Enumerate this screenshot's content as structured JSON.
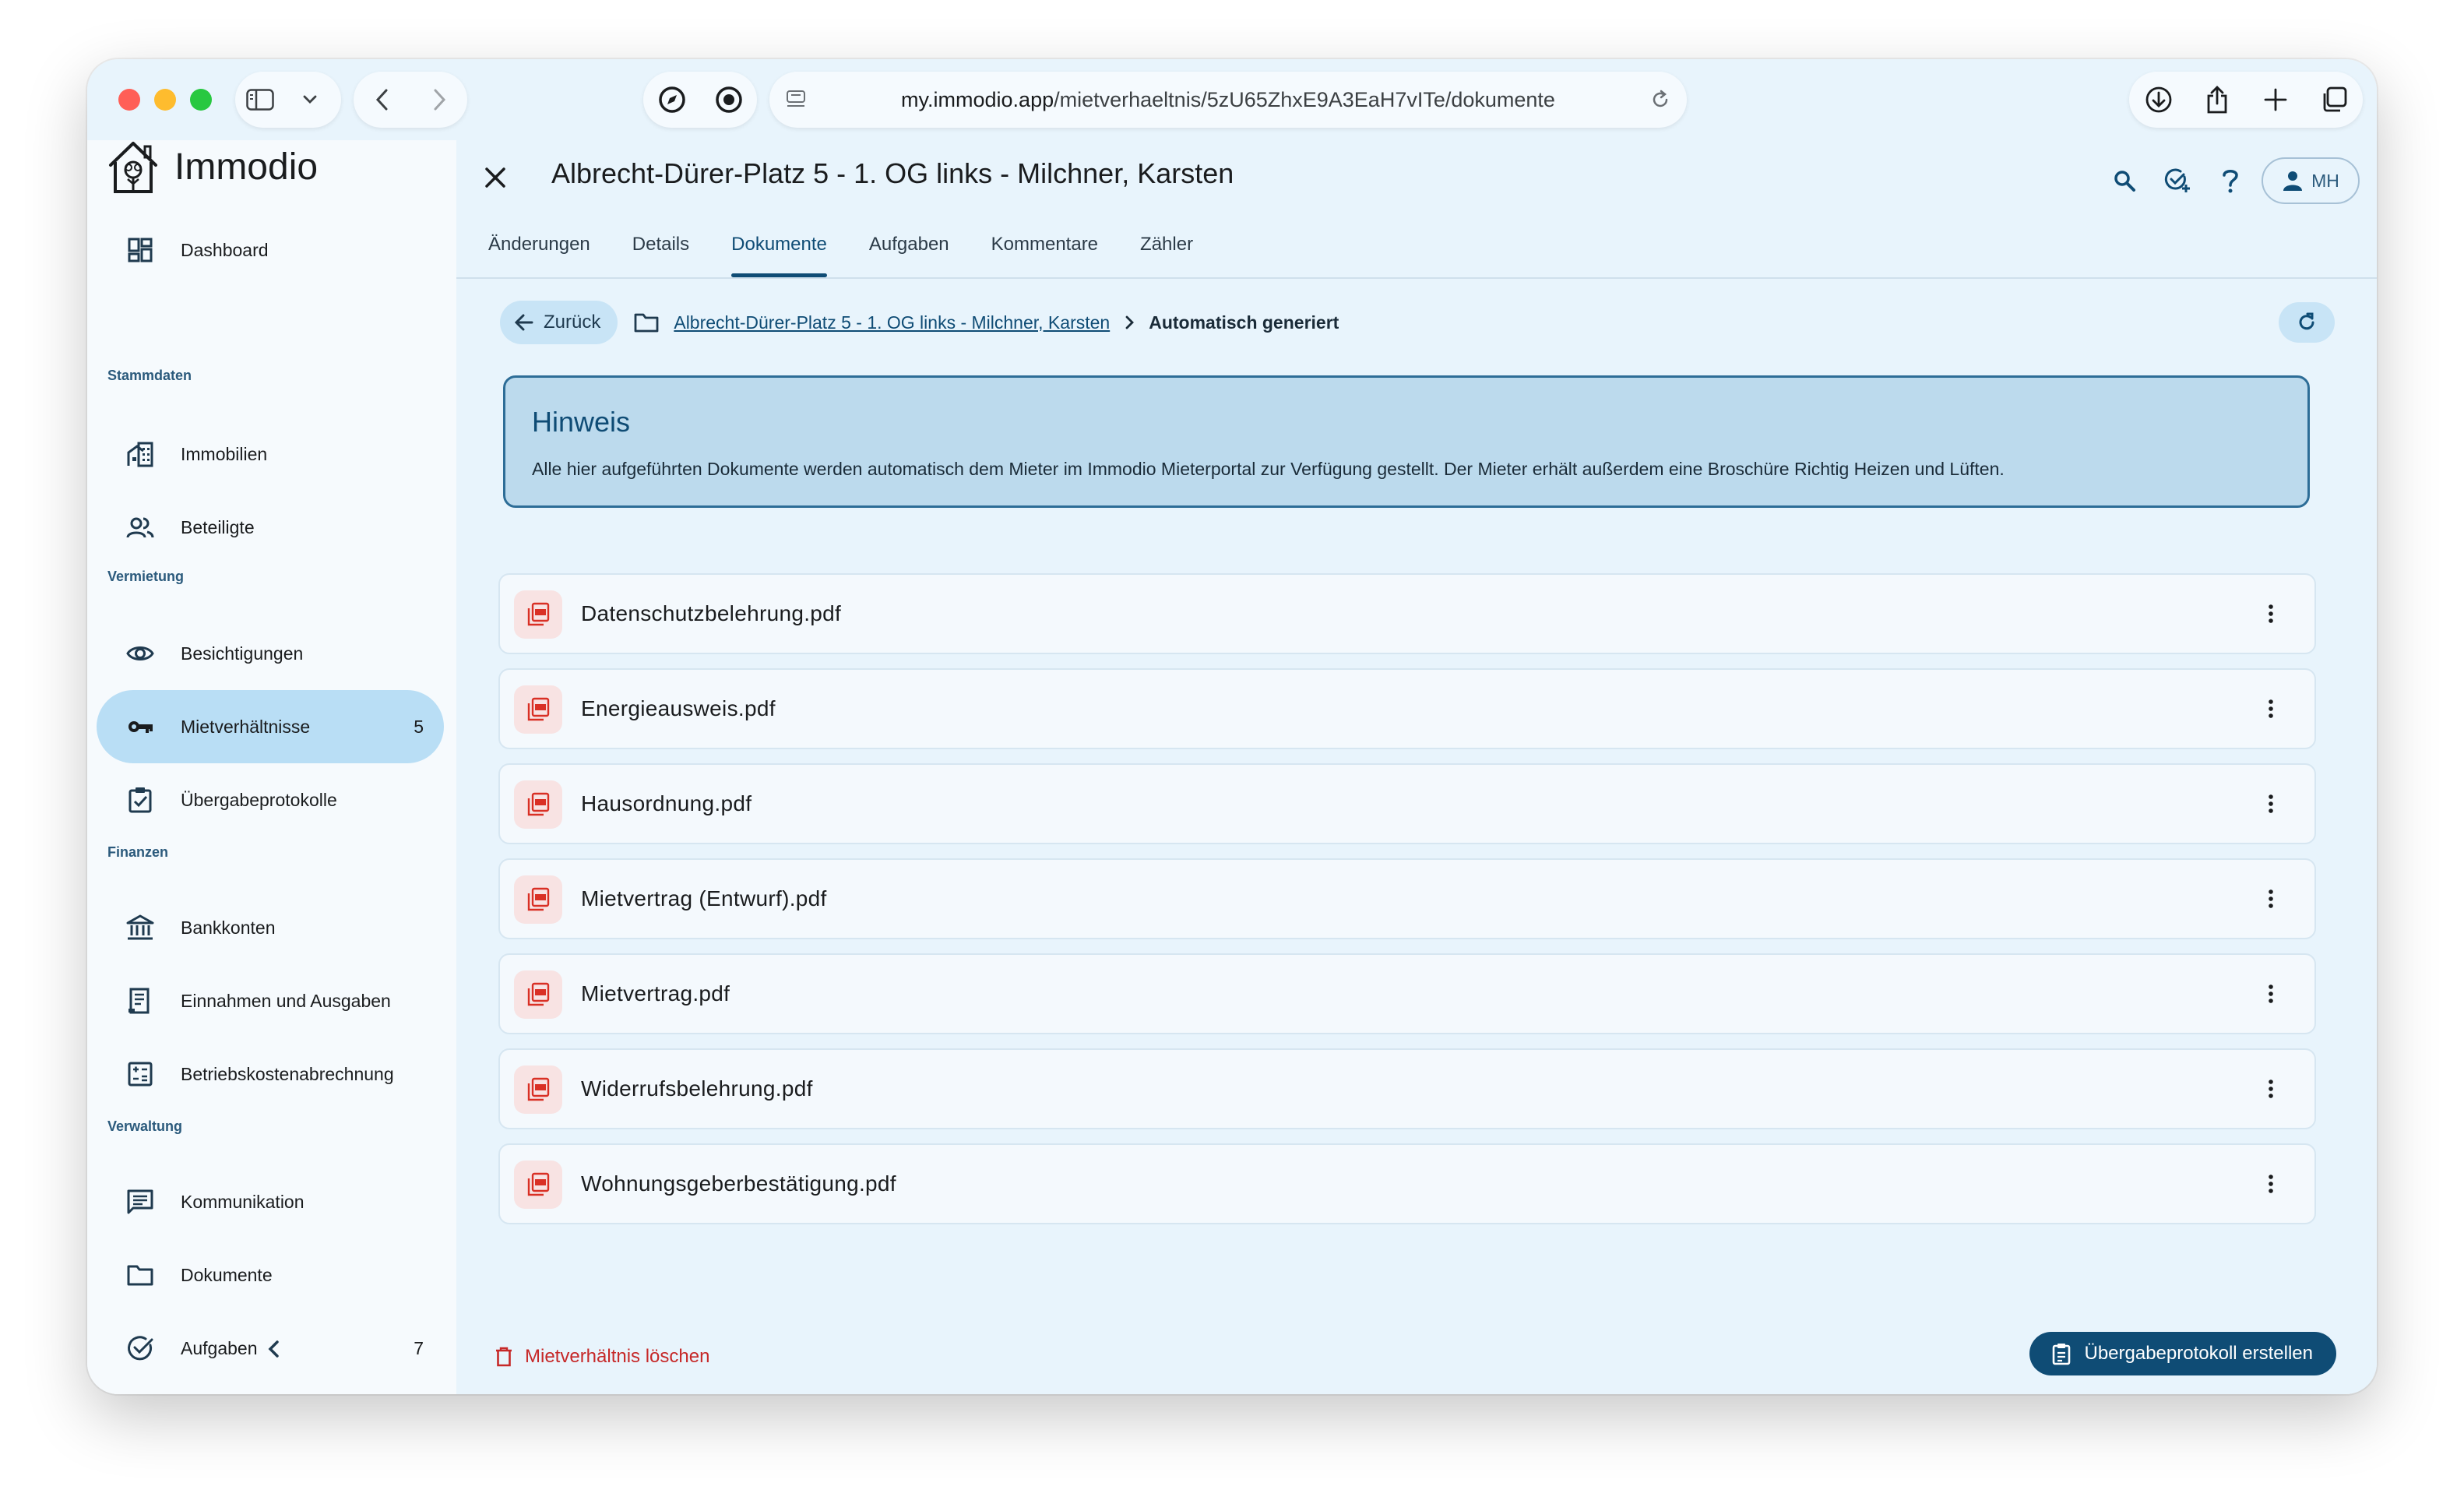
{
  "browser": {
    "url_host": "my.immodio.app",
    "url_path": "/mietverhaeltnis/5zU65ZhxE9A3EaH7vITe/dokumente"
  },
  "sidebar": {
    "app_name": "Immodio",
    "dashboard": "Dashboard",
    "sections": {
      "stammdaten": "Stammdaten",
      "vermietung": "Vermietung",
      "finanzen": "Finanzen",
      "verwaltung": "Verwaltung"
    },
    "items": {
      "immobilien": "Immobilien",
      "beteiligte": "Beteiligte",
      "besichtigungen": "Besichtigungen",
      "mietverhaeltnisse": "Mietverhältnisse",
      "mietverhaeltnisse_count": "5",
      "uebergabeprotokolle": "Übergabeprotokolle",
      "bankkonten": "Bankkonten",
      "einnahmen": "Einnahmen und Ausgaben",
      "betriebskosten": "Betriebskostenabrechnung",
      "kommunikation": "Kommunikation",
      "dokumente": "Dokumente",
      "aufgaben": "Aufgaben",
      "aufgaben_count": "7"
    }
  },
  "header": {
    "title": "Albrecht-Dürer-Platz 5 - 1. OG links - Milchner, Karsten",
    "user_initials": "MH"
  },
  "tabs": [
    "Änderungen",
    "Details",
    "Dokumente",
    "Aufgaben",
    "Kommentare",
    "Zähler"
  ],
  "breadcrumb": {
    "back_label": "Zurück",
    "parent": "Albrecht-Dürer-Platz 5 - 1. OG links - Milchner, Karsten",
    "current": "Automatisch generiert"
  },
  "notice": {
    "title": "Hinweis",
    "text": "Alle hier aufgeführten Dokumente werden automatisch dem Mieter im Immodio Mieterportal zur Verfügung gestellt. Der Mieter erhält außerdem eine Broschüre Richtig Heizen und Lüften."
  },
  "documents": [
    "Datenschutzbelehrung.pdf",
    "Energieausweis.pdf",
    "Hausordnung.pdf",
    "Mietvertrag (Entwurf).pdf",
    "Mietvertrag.pdf",
    "Widerrufsbelehrung.pdf",
    "Wohnungsgeberbestätigung.pdf"
  ],
  "footer": {
    "delete_label": "Mietverhältnis löschen",
    "create_label": "Übergabeprotokoll erstellen"
  },
  "colors": {
    "primary": "#0f4c75",
    "sidebar_active": "#b9def5",
    "danger": "#c62828",
    "pdf": "#d93025"
  }
}
